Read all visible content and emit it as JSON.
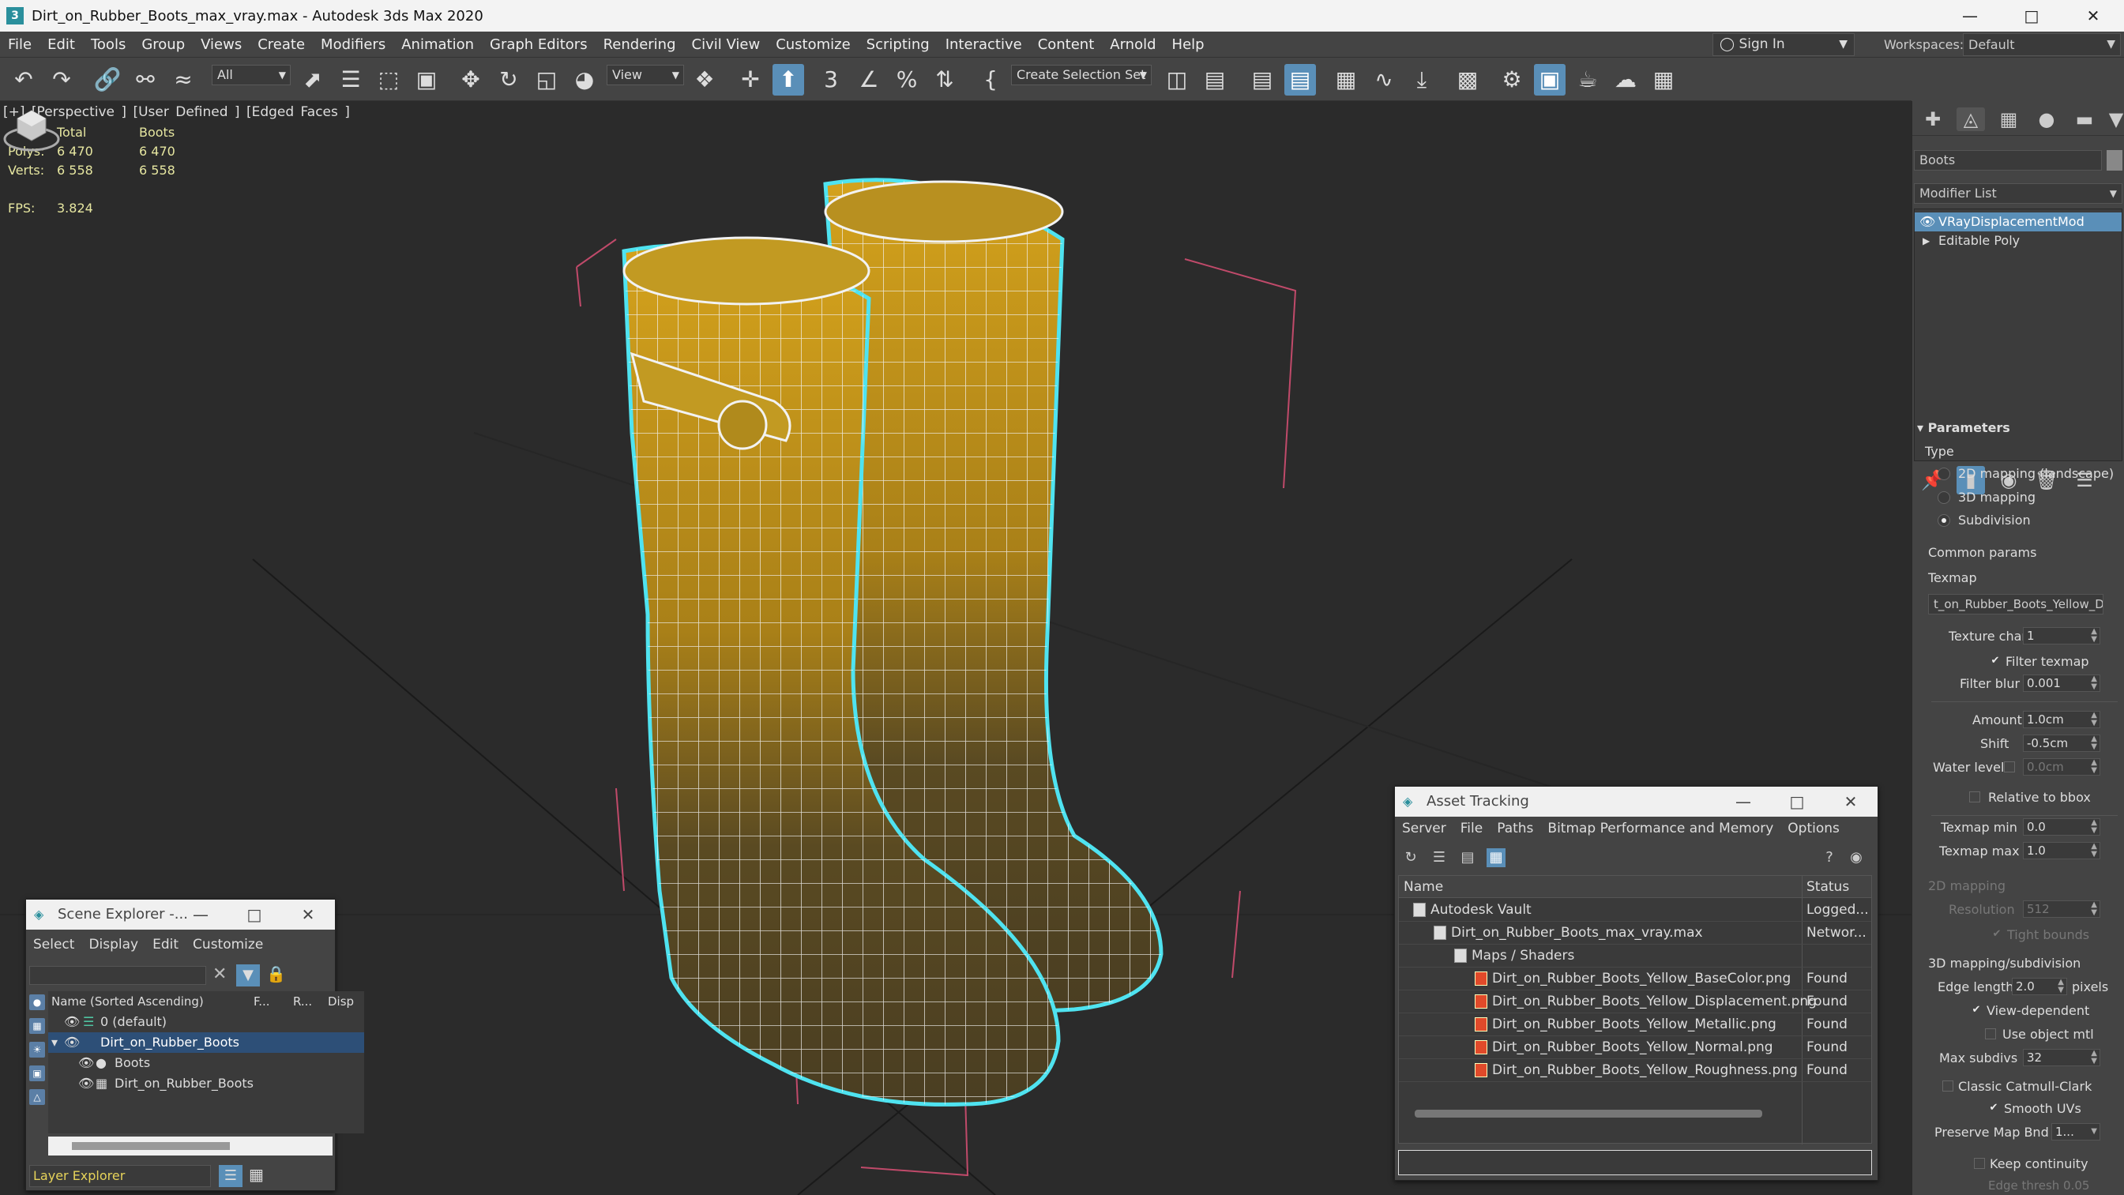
{
  "window": {
    "title": "Dirt_on_Rubber_Boots_max_vray.max - Autodesk 3ds Max 2020"
  },
  "menu": [
    "File",
    "Edit",
    "Tools",
    "Group",
    "Views",
    "Create",
    "Modifiers",
    "Animation",
    "Graph Editors",
    "Rendering",
    "Civil View",
    "Customize",
    "Scripting",
    "Interactive",
    "Content",
    "Arnold",
    "Help"
  ],
  "account": {
    "sign_in": "Sign In",
    "workspaces_label": "Workspaces:",
    "workspace": "Default"
  },
  "toolbar": {
    "filter": "All",
    "ref_coord": "View",
    "selection_set": "Create Selection Set"
  },
  "viewport": {
    "label": "[+] [Perspective ] [User Defined ] [Edged Faces ]",
    "stats": {
      "col_total": "Total",
      "col_obj": "Boots",
      "polys_label": "Polys:",
      "polys_total": "6 470",
      "polys_obj": "6 470",
      "verts_label": "Verts:",
      "verts_total": "6 558",
      "verts_obj": "6 558",
      "fps_label": "FPS:",
      "fps": "3.824"
    }
  },
  "command_panel": {
    "object_name": "Boots",
    "modifier_list": "Modifier List",
    "stack": [
      "VRayDisplacementMod",
      "Editable Poly"
    ],
    "rollout": "Parameters",
    "type_label": "Type",
    "types": [
      "2D mapping (landscape)",
      "3D mapping",
      "Subdivision"
    ],
    "selected_type": 2,
    "common_params": "Common params",
    "texmap_label": "Texmap",
    "texmap": "t_on_Rubber_Boots_Yellow_D",
    "texture_chan_label": "Texture chan",
    "texture_chan": "1",
    "filter_texmap": "Filter texmap",
    "filter_blur_label": "Filter blur",
    "filter_blur": "0.001",
    "amount_label": "Amount",
    "amount": "1.0cm",
    "shift_label": "Shift",
    "shift": "-0.5cm",
    "water_level_label": "Water level",
    "water_level": "0.0cm",
    "relative_bbox": "Relative to bbox",
    "texmap_min_label": "Texmap min",
    "texmap_min": "0.0",
    "texmap_max_label": "Texmap max",
    "texmap_max": "1.0",
    "mapping_2d": "2D mapping",
    "resolution_label": "Resolution",
    "resolution": "512",
    "tight_bounds": "Tight bounds",
    "mapping_3d": "3D mapping/subdivision",
    "edge_length_label": "Edge length",
    "edge_length": "2.0",
    "pixels": "pixels",
    "view_dependent": "View-dependent",
    "use_object_mtl": "Use object mtl",
    "max_subdivs_label": "Max subdivs",
    "max_subdivs": "32",
    "classic_catmull": "Classic Catmull-Clark",
    "smooth_uvs": "Smooth UVs",
    "preserve_map_label": "Preserve Map Bnd",
    "preserve_map": "1...",
    "keep_continuity": "Keep continuity",
    "edge_thresh": "Edge thresh 0.05"
  },
  "asset_tracking": {
    "title": "Asset Tracking",
    "menu": [
      "Server",
      "File",
      "Paths",
      "Bitmap Performance and Memory",
      "Options"
    ],
    "col_name": "Name",
    "col_status": "Status",
    "rows": [
      {
        "name": "Autodesk Vault",
        "status": "Logged...",
        "indent": 0,
        "icon": "vault"
      },
      {
        "name": "Dirt_on_Rubber_Boots_max_vray.max",
        "status": "Networ...",
        "indent": 1,
        "icon": "max"
      },
      {
        "name": "Maps / Shaders",
        "status": "",
        "indent": 2,
        "icon": "folder"
      },
      {
        "name": "Dirt_on_Rubber_Boots_Yellow_BaseColor.png",
        "status": "Found",
        "indent": 3,
        "icon": "png"
      },
      {
        "name": "Dirt_on_Rubber_Boots_Yellow_Displacement.png",
        "status": "Found",
        "indent": 3,
        "icon": "png"
      },
      {
        "name": "Dirt_on_Rubber_Boots_Yellow_Metallic.png",
        "status": "Found",
        "indent": 3,
        "icon": "png"
      },
      {
        "name": "Dirt_on_Rubber_Boots_Yellow_Normal.png",
        "status": "Found",
        "indent": 3,
        "icon": "png"
      },
      {
        "name": "Dirt_on_Rubber_Boots_Yellow_Roughness.png",
        "status": "Found",
        "indent": 3,
        "icon": "png"
      }
    ]
  },
  "scene_explorer": {
    "title": "Scene Explorer -...",
    "menu": [
      "Select",
      "Display",
      "Edit",
      "Customize"
    ],
    "col_name": "Name (Sorted Ascending)",
    "col_f": "F...",
    "col_r": "R...",
    "col_disp": "Disp",
    "items": [
      {
        "name": "0 (default)",
        "level": 0
      },
      {
        "name": "Dirt_on_Rubber_Boots",
        "level": 0,
        "selected": true
      },
      {
        "name": "Boots",
        "level": 1
      },
      {
        "name": "Dirt_on_Rubber_Boots",
        "level": 1
      }
    ],
    "layer_explorer": "Layer Explorer"
  },
  "colors": {
    "accent": "#5a8fb8",
    "boot_yellow": "#c9971a",
    "selection_outline": "#4fe3f0",
    "viewport_bg": "#2b2b2b"
  }
}
